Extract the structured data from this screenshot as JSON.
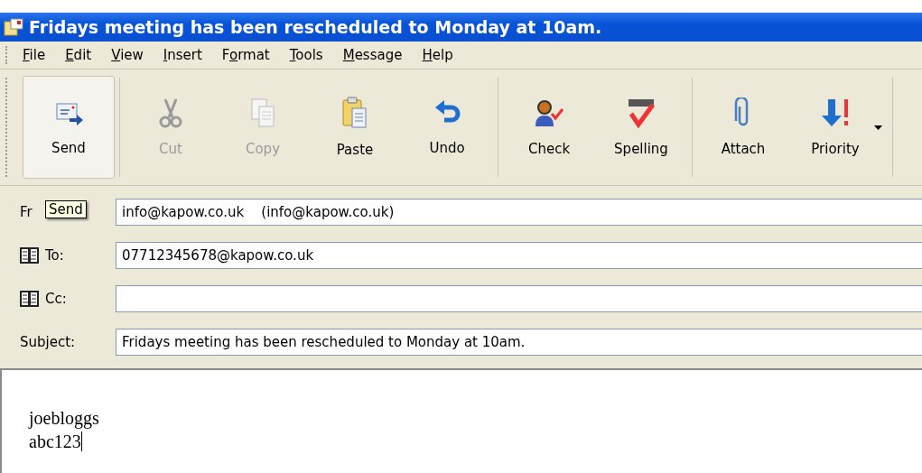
{
  "window": {
    "title": "Fridays meeting has been rescheduled to Monday at 10am."
  },
  "menu": [
    {
      "key": "F",
      "after": "ile"
    },
    {
      "key": "E",
      "after": "dit"
    },
    {
      "key": "V",
      "after": "iew"
    },
    {
      "key": "I",
      "after": "nsert"
    },
    {
      "before": "F",
      "key": "o",
      "after": "rmat"
    },
    {
      "key": "T",
      "after": "ools"
    },
    {
      "key": "M",
      "after": "essage"
    },
    {
      "key": "H",
      "after": "elp"
    }
  ],
  "toolbar": [
    {
      "kind": "send",
      "label": "Send",
      "disabled": false,
      "hovered": true,
      "separator_after": true
    },
    {
      "kind": "cut",
      "label": "Cut",
      "disabled": true,
      "hovered": false,
      "separator_after": false
    },
    {
      "kind": "copy",
      "label": "Copy",
      "disabled": true,
      "hovered": false,
      "separator_after": false
    },
    {
      "kind": "paste",
      "label": "Paste",
      "disabled": false,
      "hovered": false,
      "separator_after": false
    },
    {
      "kind": "undo",
      "label": "Undo",
      "disabled": false,
      "hovered": false,
      "separator_after": true
    },
    {
      "kind": "check",
      "label": "Check",
      "disabled": false,
      "hovered": false,
      "separator_after": false
    },
    {
      "kind": "spelling",
      "label": "Spelling",
      "disabled": false,
      "hovered": false,
      "separator_after": true
    },
    {
      "kind": "attach",
      "label": "Attach",
      "disabled": false,
      "hovered": false,
      "separator_after": false
    },
    {
      "kind": "priority",
      "label": "Priority",
      "disabled": false,
      "hovered": false,
      "separator_after": true
    }
  ],
  "tooltip": "Send",
  "fields": [
    {
      "label": "Fr",
      "address_book": false,
      "value": "info@kapow.co.uk    (info@kapow.co.uk)"
    },
    {
      "label": "To:",
      "address_book": true,
      "value": "07712345678@kapow.co.uk"
    },
    {
      "label": "Cc:",
      "address_book": true
    },
    {
      "label": "Subject:",
      "address_book": false,
      "value": "Fridays meeting has been rescheduled to Monday at 10am."
    }
  ],
  "body": {
    "lines": [
      "joebloggs",
      "abc123"
    ]
  }
}
